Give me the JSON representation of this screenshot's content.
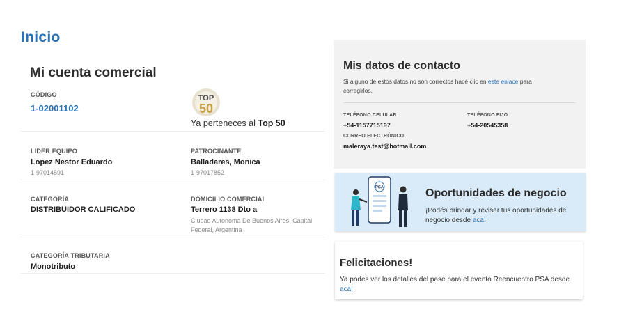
{
  "page": {
    "title": "Inicio"
  },
  "account": {
    "title": "Mi cuenta comercial",
    "code_label": "CÓDIGO",
    "code_value": "1-02001102",
    "top50": {
      "badge_top": "TOP",
      "badge_number": "50",
      "prefix": "Ya perteneces al",
      "highlight": "Top 50"
    },
    "leader": {
      "label": "LIDER EQUIPO",
      "name": "Lopez Nestor Eduardo",
      "id": "1-97014591"
    },
    "sponsor": {
      "label": "PATROCINANTE",
      "name": "Balladares, Monica",
      "id": "1-97017852"
    },
    "category": {
      "label": "CATEGORÍA",
      "value": "DISTRIBUIDOR CALIFICADO"
    },
    "address": {
      "label": "DOMICILIO COMERCIAL",
      "value": "Terrero 1138 Dto a",
      "detail": "Ciudad Autonoma De Buenos Aires, Capital Federal, Argentina"
    },
    "tax_category": {
      "label": "CATEGORÍA TRIBUTARIA",
      "value": "Monotributo"
    }
  },
  "contact": {
    "title": "Mis datos de contacto",
    "desc_before": "Si alguno de estos datos no son correctos hacé clic en",
    "desc_link": "este enlace",
    "desc_after": "para corregirlos.",
    "mobile_label": "TELÉFONO CELULAR",
    "mobile_value": "+54-1157715197",
    "landline_label": "TELÉFONO FIJO",
    "landline_value": "+54-20545358",
    "email_label": "CORREO ELECTRÓNICO",
    "email_value": "maleraya.test@hotmail.com"
  },
  "opportunities": {
    "title": "Oportunidades de negocio",
    "desc": "¡Podés brindar y revisar tus oportunidades de negocio desde",
    "link": "aca!",
    "phone_logo": "PSA"
  },
  "congrats": {
    "title": "Felicitaciones!",
    "desc": "Ya podes ver los detalles del pase para el evento Reencuentro PSA desde",
    "link": "aca!"
  },
  "colors": {
    "accent": "#2872b8",
    "panel_bg": "#f2f2f2",
    "opp_bg": "#d9ebf8",
    "badge_gold": "#c8a04a",
    "badge_dark": "#4a4a4a"
  }
}
